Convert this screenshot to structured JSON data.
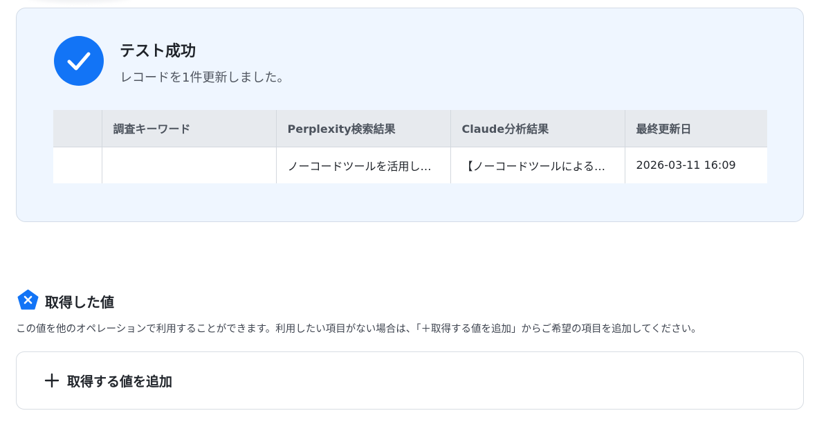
{
  "test_result": {
    "title": "テスト成功",
    "message": "レコードを1件更新しました。",
    "table": {
      "headers": [
        "",
        "調査キーワード",
        "Perplexity検索結果",
        "Claude分析結果",
        "最終更新日"
      ],
      "rows": [
        [
          "",
          "",
          "ノーコードツールを活用し…",
          "【ノーコードツールによる…",
          "2026-03-11 16:09"
        ]
      ]
    }
  },
  "acquired_values": {
    "icon": "yoom-x-pentagon-icon",
    "title": "取得した値",
    "description": "この値を他のオペレーションで利用することができます。利用したい項目がない場合は、「＋取得する値を追加」からご希望の項目を追加してください。",
    "add_button_label": "取得する値を追加"
  },
  "colors": {
    "accent": "#1274f6",
    "card_background": "#eff6ff",
    "table_header": "#e7eaee"
  }
}
